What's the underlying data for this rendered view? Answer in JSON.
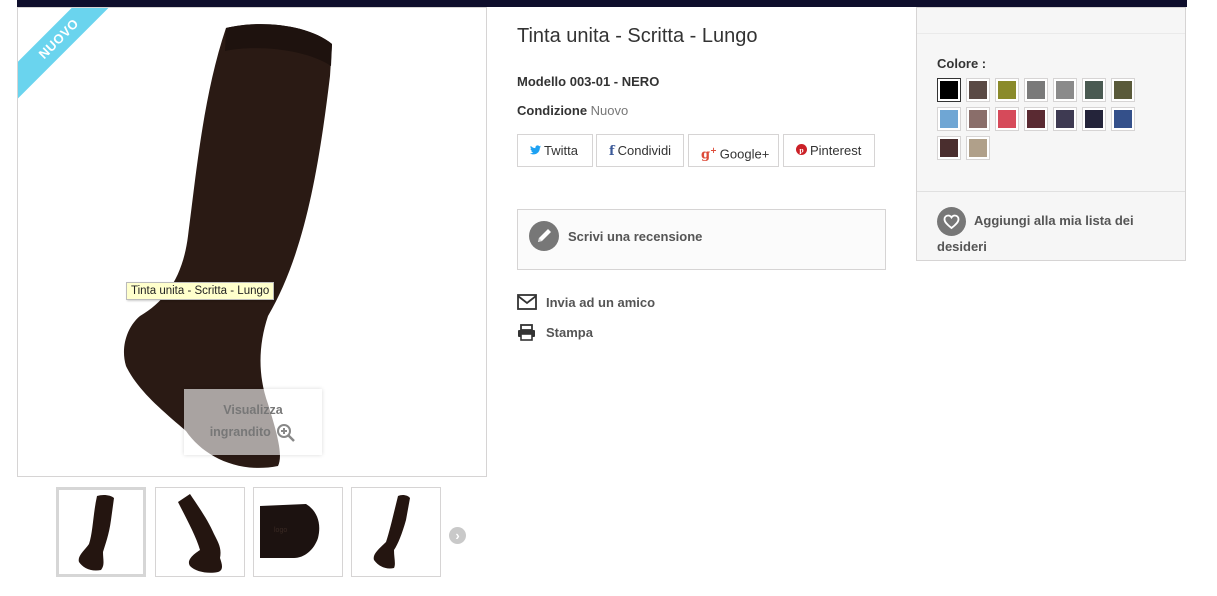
{
  "product": {
    "badge": "NUOVO",
    "title": "Tinta unita - Scritta - Lungo",
    "model_text": "Modello 003-01 - NERO",
    "condition_label": "Condizione",
    "condition_value": "Nuovo",
    "tooltip": "Tinta unita - Scritta - Lungo",
    "zoom_line1": "Visualizza",
    "zoom_line2": "ingrandito"
  },
  "thumbnails": [
    {
      "name": "thumb-1",
      "active": true
    },
    {
      "name": "thumb-2",
      "active": false
    },
    {
      "name": "thumb-3",
      "active": false
    },
    {
      "name": "thumb-4",
      "active": false
    }
  ],
  "social": {
    "twitter": "Twitta",
    "facebook": "Condividi",
    "google": "Google+",
    "pinterest": "Pinterest"
  },
  "review": {
    "label": "Scrivi una recensione"
  },
  "actions": {
    "send_friend": "Invia ad un amico",
    "print": "Stampa"
  },
  "colors": {
    "label": "Colore :",
    "selected_index": 0,
    "swatches": [
      "#000000",
      "#5a4a45",
      "#8a8a2a",
      "#7a7a7a",
      "#8a8a8a",
      "#4a5a52",
      "#5a5a3a",
      "#6fa6d4",
      "#8a6e6a",
      "#d64a5a",
      "#5a2a32",
      "#3e3a52",
      "#24243a",
      "#34508a",
      "#4a2e2e",
      "#b0a08a"
    ]
  },
  "wishlist": {
    "label": "Aggiungi alla mia lista dei desideri"
  },
  "theme": {
    "accent_ribbon": "#6ad4ee",
    "top_bar": "#0e0e2c",
    "twitter_blue": "#1da1f2",
    "facebook_blue": "#3b5998",
    "google_red": "#dd4b39",
    "pinterest_red": "#cb2027"
  }
}
